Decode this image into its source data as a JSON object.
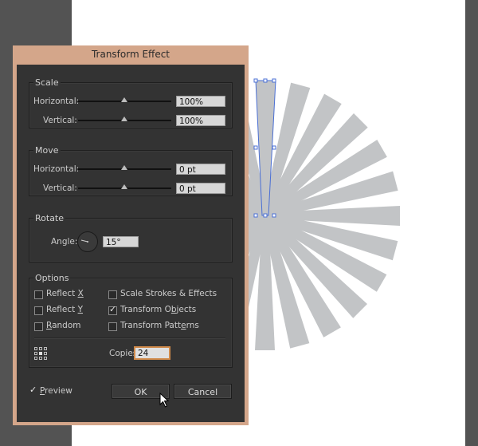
{
  "dialog": {
    "title": "Transform Effect",
    "scale": {
      "legend": "Scale",
      "horizontal_label": "Horizontal:",
      "horizontal_value": "100%",
      "vertical_label": "Vertical:",
      "vertical_value": "100%"
    },
    "move": {
      "legend": "Move",
      "horizontal_label": "Horizontal:",
      "horizontal_value": "0 pt",
      "vertical_label": "Vertical:",
      "vertical_value": "0 pt"
    },
    "rotate": {
      "legend": "Rotate",
      "angle_label": "Angle:",
      "angle_value": "15°"
    },
    "options": {
      "legend": "Options",
      "reflect_x": {
        "label": "Reflect X",
        "checked": false
      },
      "reflect_y": {
        "label": "Reflect Y",
        "checked": false
      },
      "random": {
        "label": "Random",
        "checked": false
      },
      "scale_strokes": {
        "label": "Scale Strokes & Effects",
        "checked": false
      },
      "transform_objects": {
        "label": "Transform Objects",
        "checked": true
      },
      "transform_patterns": {
        "label": "Transform Patterns",
        "checked": false
      },
      "copies_label": "Copies",
      "copies_value": "24"
    },
    "preview": {
      "label": "Preview",
      "checked": true
    },
    "ok_label": "OK",
    "cancel_label": "Cancel"
  },
  "colors": {
    "app_background": "#535353",
    "dialog_frame": "#d4a68a",
    "dialog_body": "#333333",
    "ray_fill": "#c2c4c6",
    "selection_blue": "#4a6fd4",
    "focus_orange": "#d08a4a"
  },
  "icons": [
    "reference-point-grid-icon",
    "angle-dial-icon",
    "checkmark-icon",
    "mouse-cursor-icon"
  ]
}
